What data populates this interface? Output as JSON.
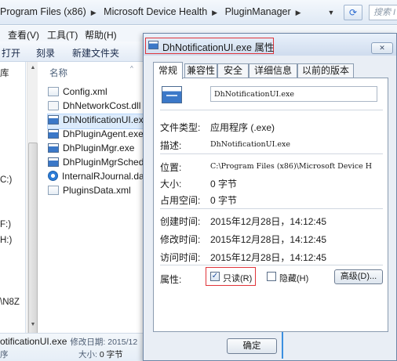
{
  "address_bar": {
    "crumbs": [
      "Program Files (x86)",
      "Microsoft Device Health",
      "PluginManager"
    ],
    "search_placeholder": "搜索 I"
  },
  "menu": [
    "查看(V)",
    "工具(T)",
    "帮助(H)"
  ],
  "toolbar": [
    "打开",
    "刻录",
    "新建文件夹"
  ],
  "nav": {
    "items": [
      "库",
      "C:)",
      "F:)",
      "H:)",
      "\\N8Z"
    ]
  },
  "file_list": {
    "column_header": "名称",
    "files": [
      {
        "name": "Config.xml",
        "icon": "xml-file-icon"
      },
      {
        "name": "DhNetworkCost.dll",
        "icon": "dll-file-icon"
      },
      {
        "name": "DhNotificationUI.exe",
        "icon": "exe-file-icon",
        "selected": true
      },
      {
        "name": "DhPluginAgent.exe",
        "icon": "exe-file-icon"
      },
      {
        "name": "DhPluginMgr.exe",
        "icon": "exe-file-icon"
      },
      {
        "name": "DhPluginMgrSchedu",
        "icon": "exe-file-icon"
      },
      {
        "name": "InternalRJournal.dat",
        "icon": "dat-file-icon"
      },
      {
        "name": "PluginsData.xml",
        "icon": "xml-file-icon"
      }
    ]
  },
  "details_pane": {
    "name": "otificationUI.exe",
    "modified_label": "修改日期: 2015/12",
    "type_fragment": "序",
    "size_label": "大小:",
    "size_value": "0 字节"
  },
  "dialog": {
    "title": "DhNotificationUI.exe 属性",
    "close": "✕",
    "tabs": [
      "常规",
      "兼容性",
      "安全",
      "详细信息",
      "以前的版本"
    ],
    "active_tab": "常规",
    "file_name": "DhNotificationUI.exe",
    "fields": {
      "type": {
        "label": "文件类型:",
        "value": "应用程序 (.exe)"
      },
      "description": {
        "label": "描述:",
        "value": "DhNotificationUI.exe"
      },
      "location": {
        "label": "位置:",
        "value": "C:\\Program Files (x86)\\Microsoft Device H"
      },
      "size": {
        "label": "大小:",
        "value": "0 字节"
      },
      "size_on_disk": {
        "label": "占用空间:",
        "value": "0 字节"
      },
      "created": {
        "label": "创建时间:",
        "value": "2015年12月28日，14:12:45"
      },
      "modified": {
        "label": "修改时间:",
        "value": "2015年12月28日，14:12:45"
      },
      "accessed": {
        "label": "访问时间:",
        "value": "2015年12月28日，14:12:45"
      }
    },
    "attributes": {
      "label": "属性:",
      "readonly": {
        "label": "只读(R)",
        "checked": true
      },
      "hidden": {
        "label": "隐藏(H)",
        "checked": false
      },
      "advanced_button": "高级(D)..."
    },
    "ok_button": "确定"
  },
  "colors": {
    "highlight_border": "#e0343a",
    "selection": "#dcebfc",
    "dialog_bg": "#e9eef5"
  }
}
